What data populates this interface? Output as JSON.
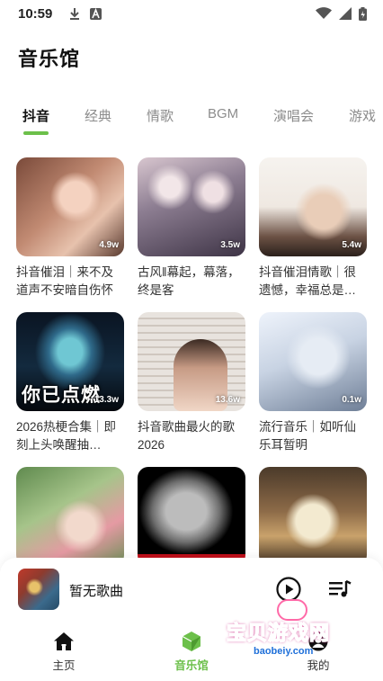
{
  "status_bar": {
    "time": "10:59"
  },
  "page_title": "音乐馆",
  "tabs": [
    {
      "label": "抖音",
      "active": true
    },
    {
      "label": "经典",
      "active": false
    },
    {
      "label": "情歌",
      "active": false
    },
    {
      "label": "BGM",
      "active": false
    },
    {
      "label": "演唱会",
      "active": false
    },
    {
      "label": "游戏",
      "active": false
    }
  ],
  "cards": [
    {
      "title": "抖音催泪｜来不及道声不安暗自伤怀",
      "count": "4.9w"
    },
    {
      "title": "古风‖幕起，幕落，终是客",
      "count": "3.5w"
    },
    {
      "title": "抖音催泪情歌｜很遗憾，幸福总是…",
      "count": "5.4w"
    },
    {
      "title": "2026热梗合集｜即刻上头唤醒抽…",
      "count": "13.3w",
      "overlay": "你已点燃"
    },
    {
      "title": "抖音歌曲最火的歌2026",
      "count": "13.6w"
    },
    {
      "title": "流行音乐｜如听仙乐耳暂明",
      "count": "0.1w"
    },
    {
      "title": "",
      "count": ""
    },
    {
      "title": "",
      "count": ""
    },
    {
      "title": "",
      "count": ""
    }
  ],
  "player": {
    "song_title": "暂无歌曲"
  },
  "bottom_nav": [
    {
      "label": "主页",
      "active": false
    },
    {
      "label": "音乐馆",
      "active": true
    },
    {
      "label": "我的",
      "active": false
    }
  ],
  "watermark": {
    "text": "宝贝游戏网",
    "url": "baobeiy.com"
  },
  "colors": {
    "accent": "#6cc04a",
    "watermark_pink": "#ff6aa8",
    "watermark_blue": "#1e6fd9"
  }
}
